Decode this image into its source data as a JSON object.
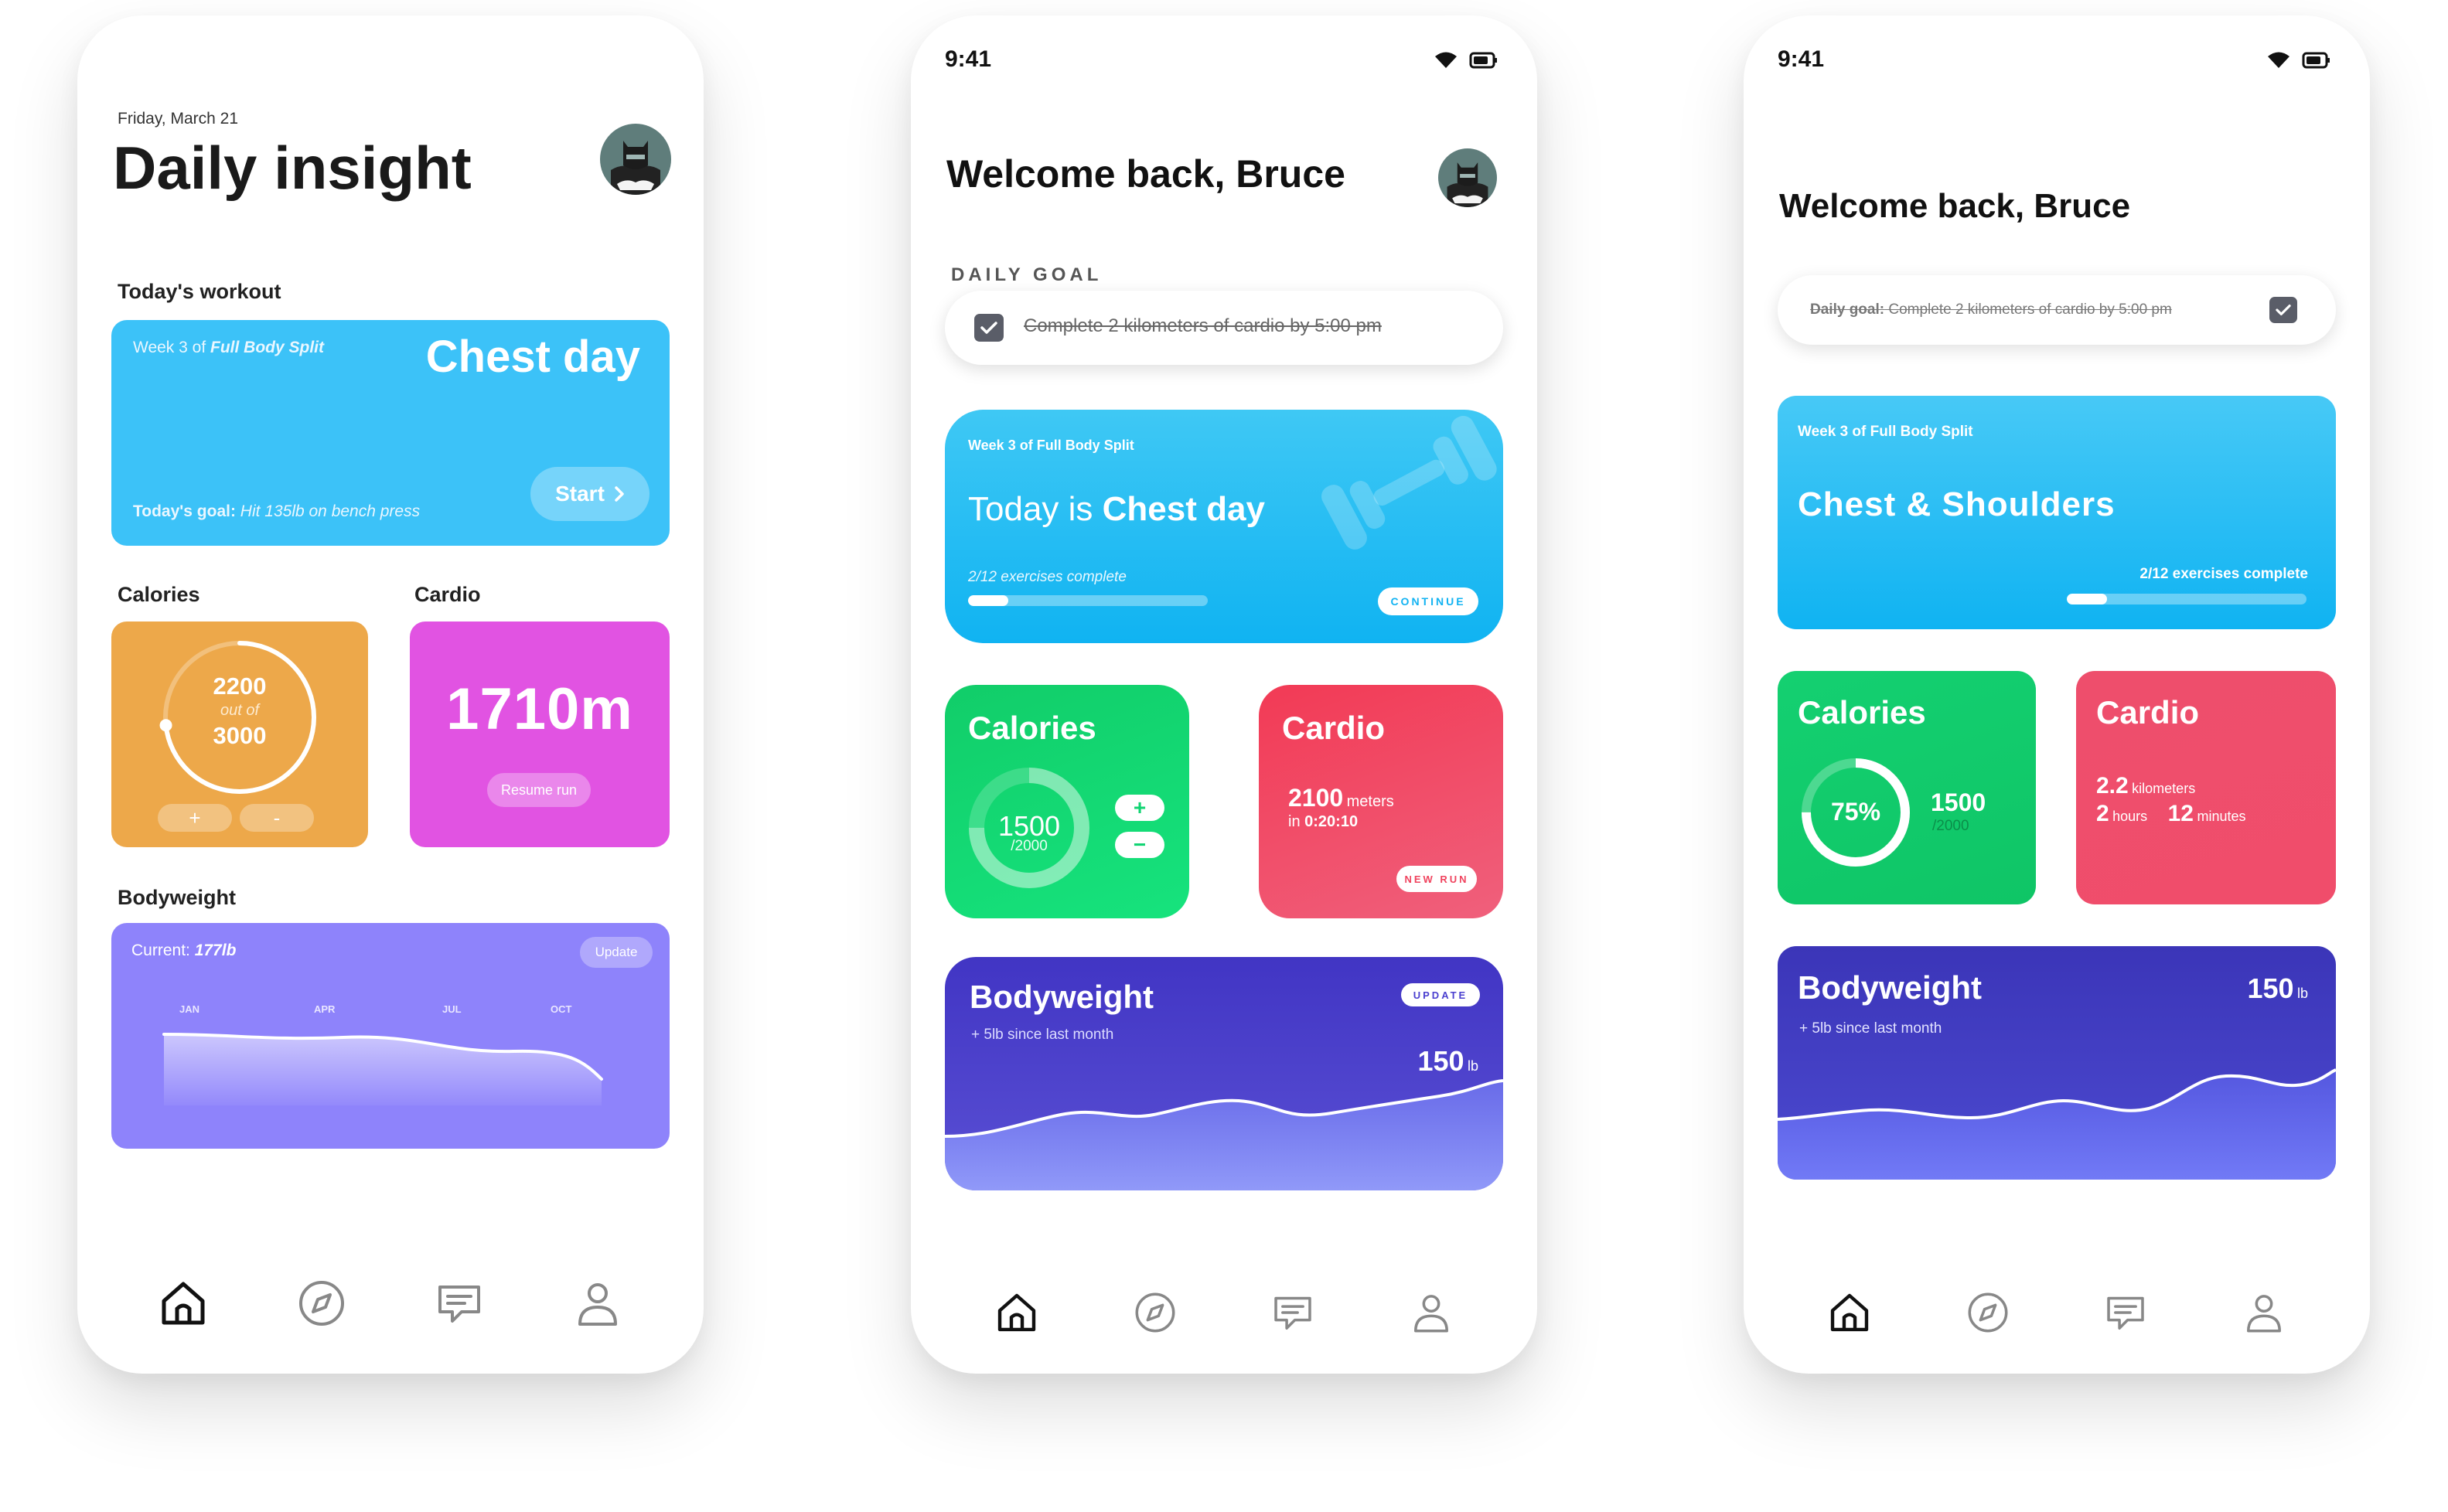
{
  "p1": {
    "date": "Friday, March 21",
    "title": "Daily insight",
    "section_workout": "Today's workout",
    "workout": {
      "week_prefix": "Week 3 of ",
      "program": "Full Body Split",
      "title": "Chest day",
      "goal_label": "Today's goal:",
      "goal_text": " Hit 135lb on bench press",
      "start": "Start"
    },
    "calories": {
      "label": "Calories",
      "value": "2200",
      "out_of": "out of",
      "total": "3000",
      "plus": "+",
      "minus": "-",
      "progress": 0.733
    },
    "cardio": {
      "label": "Cardio",
      "value": "1710m",
      "button": "Resume run"
    },
    "bodyweight": {
      "label": "Bodyweight",
      "current_label": "Current:",
      "current_value": "177lb",
      "update": "Update",
      "months": [
        "JAN",
        "APR",
        "JUL",
        "OCT"
      ]
    }
  },
  "p2": {
    "time": "9:41",
    "title": "Welcome back, Bruce",
    "daily_goal_label": "DAILY GOAL",
    "goal_text": "Complete 2 kilometers of cardio by 5:00 pm",
    "goal_checked": true,
    "workout": {
      "week": "Week 3 of Full Body Split",
      "today_is": "Today is ",
      "title": "Chest day",
      "progress_text": "2/12 exercises complete",
      "progress": 0.167,
      "continue": "CONTINUE"
    },
    "calories": {
      "label": "Calories",
      "value": "1500",
      "total": "/2000",
      "plus": "+",
      "minus": "−",
      "progress": 0.75
    },
    "cardio": {
      "label": "Cardio",
      "distance": "2100",
      "distance_unit": "meters",
      "in_label": "in",
      "duration": "0:20:10",
      "button": "NEW RUN"
    },
    "bodyweight": {
      "label": "Bodyweight",
      "change": "+ 5lb since last month",
      "value": "150",
      "unit": "lb",
      "update": "UPDATE"
    }
  },
  "p3": {
    "time": "9:41",
    "title": "Welcome back, Bruce",
    "goal_label": "Daily goal:",
    "goal_text": " Complete 2 kilometers of cardio by 5:00 pm",
    "goal_checked": true,
    "workout": {
      "week": "Week 3 of Full Body Split",
      "title": "Chest & Shoulders",
      "progress_text": "2/12 exercises complete",
      "progress": 0.167
    },
    "calories": {
      "label": "Calories",
      "percent": "75%",
      "value": "1500",
      "total": "/2000",
      "progress": 0.75
    },
    "cardio": {
      "label": "Cardio",
      "km": "2.2",
      "km_unit": "kilometers",
      "hours": "2",
      "hours_unit": "hours",
      "minutes": "12",
      "minutes_unit": "minutes"
    },
    "bodyweight": {
      "label": "Bodyweight",
      "change": "+ 5lb since last month",
      "value": "150",
      "unit": "lb"
    }
  },
  "nav_icons": [
    "home-icon",
    "compass-icon",
    "chat-icon",
    "profile-icon"
  ],
  "colors": {
    "blue": "#3cc2f8",
    "orange": "#eda84a",
    "magenta": "#e153e2",
    "purple": "#8e83fb",
    "green": "#10d472",
    "red": "#f04d6b",
    "indigo": "#4040c8"
  }
}
